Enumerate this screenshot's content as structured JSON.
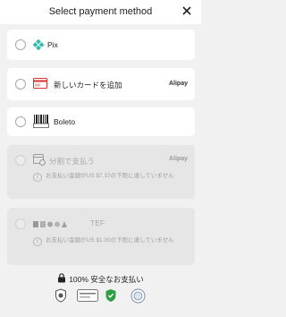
{
  "header": {
    "title": "Select payment method"
  },
  "methods": [
    {
      "label": "Pix",
      "provider": ""
    },
    {
      "label": "新しいカードを追加",
      "provider": "Alipay",
      "card_icon_text": "Card"
    },
    {
      "label": "Boleto",
      "provider": "",
      "icon_text": "Boleto"
    },
    {
      "label": "分割で支払う",
      "provider": "Alipay",
      "note": "お支払い金額がUS $7.37の下限に達していません"
    },
    {
      "label": "TEF",
      "provider": "",
      "note": "お支払い金額がUS $1.00の下限に達していません"
    }
  ],
  "footer": {
    "secure_text": "100% 安全なお支払い"
  },
  "colors": {
    "pix": "#32bcad",
    "card_red": "#d9322f",
    "green_shield": "#2e9e44"
  }
}
